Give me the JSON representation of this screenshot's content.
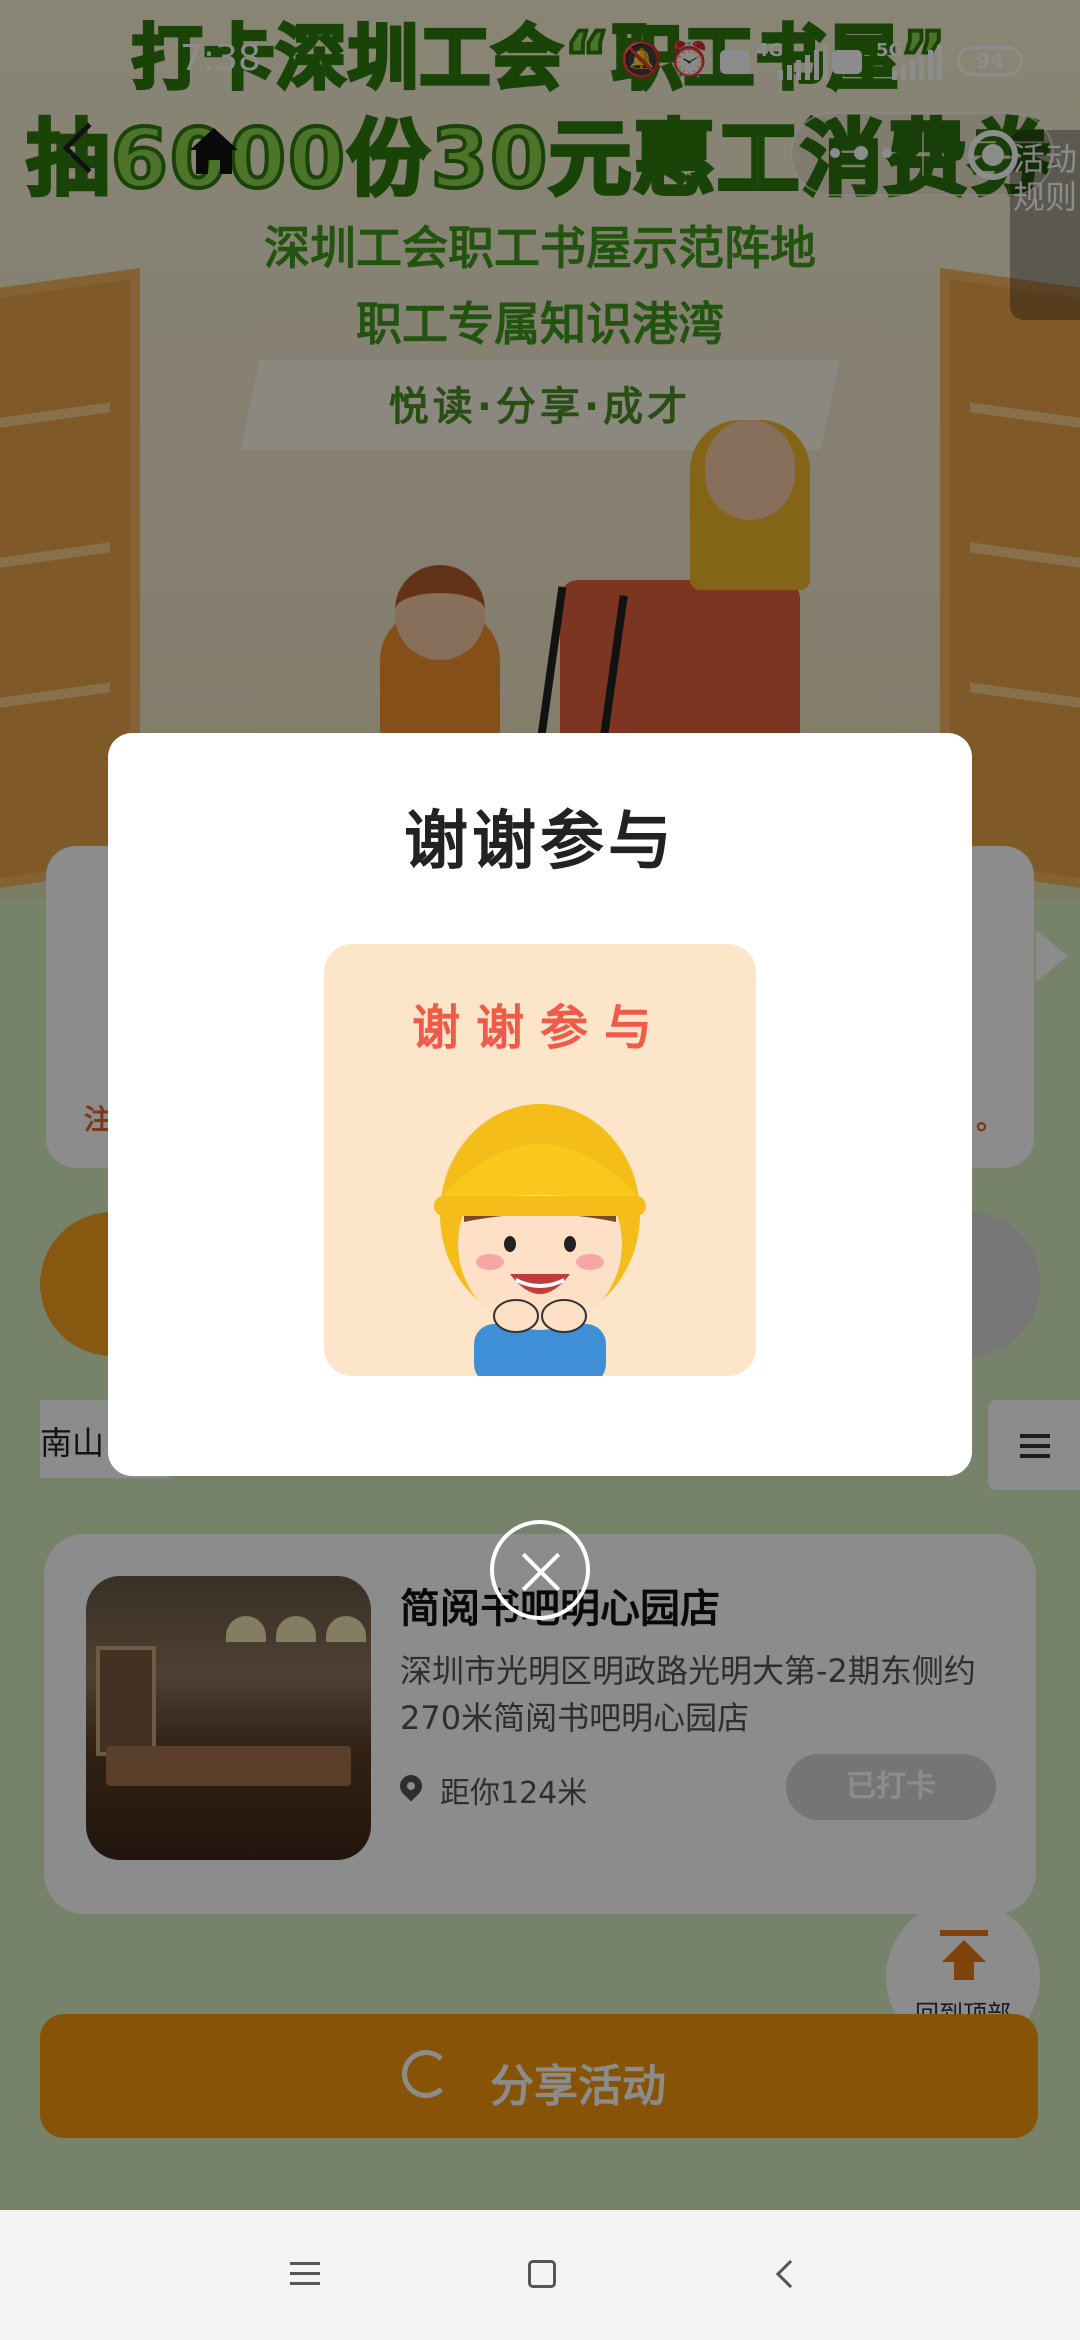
{
  "status_bar": {
    "time": "7:38",
    "net_4g": "4G",
    "net_5g": "5G",
    "hd": "HD",
    "battery": "94"
  },
  "header": {
    "back_icon": "back-arrow",
    "home_icon": "home"
  },
  "hero": {
    "title_line1": "打卡深圳工会“职工书屋”",
    "title_line2": "抽6000份30元惠工消费券",
    "subtitle_line1": "深圳工会职工书屋示范阵地",
    "subtitle_line2": "职工专属知识港湾",
    "slogan": "悦读·分享·成才",
    "rules_tab": "活动规则"
  },
  "notice": {
    "prefix": "注",
    "suffix": "。"
  },
  "filter": {
    "district": "南山"
  },
  "store": {
    "name": "简阅书吧明心园店",
    "address": "深圳市光明区明政路光明大第-2期东侧约270米简阅书吧明心园店",
    "distance": "距你124米",
    "status_button": "已打卡"
  },
  "back_to_top": "回到顶部",
  "share_button": "分享活动",
  "modal": {
    "title": "谢谢参与",
    "prize_text": "谢谢参与",
    "close_icon": "close-circle"
  },
  "colors": {
    "accent_orange": "#f69a0d",
    "prize_red": "#ef5a4a",
    "title_green": "#8ed14f"
  }
}
